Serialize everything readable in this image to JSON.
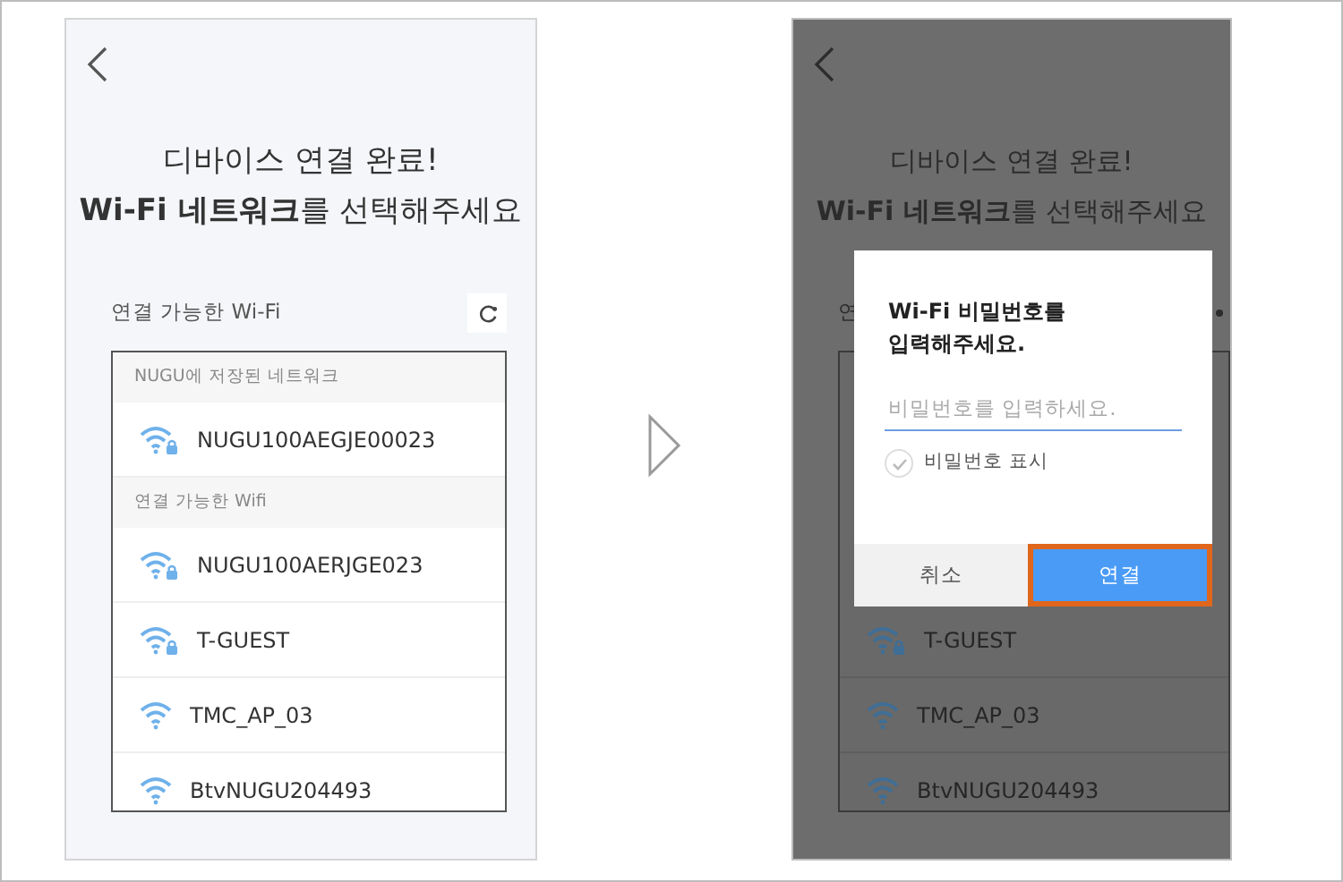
{
  "left_screen": {
    "title_lines": [
      "디바이스 연결 완료!",
      "**Wi-Fi 네트워크**를 선택해주세요"
    ],
    "list_label": "연결 가능한 Wi-Fi",
    "sections": [
      {
        "header": "NUGU에 저장된 네트워크",
        "networks": [
          {
            "name": "NUGU100AEGJE00023",
            "locked": true
          }
        ]
      },
      {
        "header": "연결 가능한 Wifi",
        "networks": [
          {
            "name": "NUGU100AERJGE023",
            "locked": true
          },
          {
            "name": "T-GUEST",
            "locked": true
          },
          {
            "name": "TMC_AP_03",
            "locked": false
          },
          {
            "name": "BtvNUGU204493",
            "locked": false
          }
        ]
      }
    ]
  },
  "right_screen": {
    "title_lines": [
      "디바이스 연결 완료!",
      "**Wi-Fi 네트워크**를 선택해주세요"
    ],
    "list_label": "연",
    "networks": [
      {
        "name": "T-GUEST",
        "locked": true
      },
      {
        "name": "TMC_AP_03",
        "locked": false
      },
      {
        "name": "BtvNUGU204493",
        "locked": false
      }
    ],
    "dialog": {
      "title_lines": [
        "Wi-Fi 비밀번호를",
        "입력해주세요."
      ],
      "password_field": {
        "placeholder": "비밀번호를 입력하세요."
      },
      "show_password": {
        "label": "비밀번호 표시",
        "checked": false
      },
      "buttons": [
        {
          "label": "취소",
          "kind": "cancel",
          "highlighted": false
        },
        {
          "label": "연결",
          "kind": "confirm",
          "highlighted": true
        }
      ]
    }
  }
}
